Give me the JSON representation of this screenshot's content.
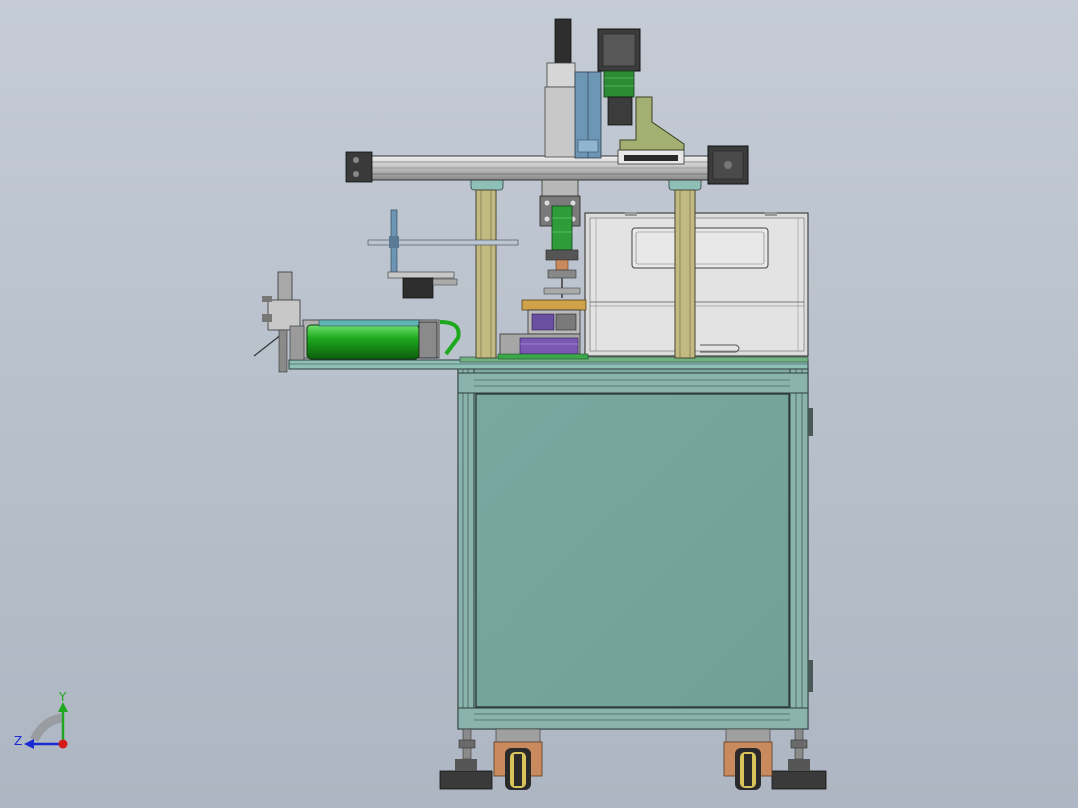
{
  "viewport": {
    "background_top": "#c5ccd6",
    "background_bottom": "#adb6c2"
  },
  "triad": {
    "y_label": "Y",
    "z_label": "Z",
    "y_color": "#1fa81f",
    "z_color": "#1a2bd6",
    "origin_color": "#d61a1a"
  },
  "colors": {
    "frame_teal": "#7fa9a3",
    "panel_teal": "#78a59e",
    "frame_edge": "#3a4a4a",
    "enclosure_gray": "#d9d9d9",
    "cylinder_green": "#1ea81e",
    "column_olive": "#b9b27a",
    "motor_dark": "#3c3c3c",
    "bracket_olive": "#9fae6a",
    "wheel_copper": "#c98a5e",
    "accent_blue": "#5f8fb3",
    "pcb_green": "#3da84a"
  }
}
